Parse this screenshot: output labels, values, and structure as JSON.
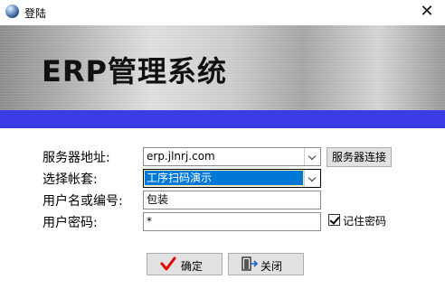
{
  "window": {
    "title": "登陆",
    "close_glyph": "✕"
  },
  "banner": {
    "title": "ERP管理系统"
  },
  "form": {
    "server_label": "服务器地址:",
    "server_value": "erp.jlnrj.com",
    "connect_button": "服务器连接",
    "account_label": "选择帐套:",
    "account_value": "工序扫码演示",
    "username_label": "用户名或编号:",
    "username_value": "包装",
    "password_label": "用户密码:",
    "password_value": "*",
    "remember_label": "记住密码",
    "remember_checked": true
  },
  "buttons": {
    "ok": "确定",
    "close": "关闭"
  },
  "colors": {
    "accent_stripe": "#3c3ce6",
    "selection": "#0078d7",
    "ok_check": "#e00000"
  },
  "icons": [
    "globe-icon",
    "close-icon",
    "check-mark-icon",
    "exit-door-icon",
    "dropdown-arrow-icon"
  ]
}
